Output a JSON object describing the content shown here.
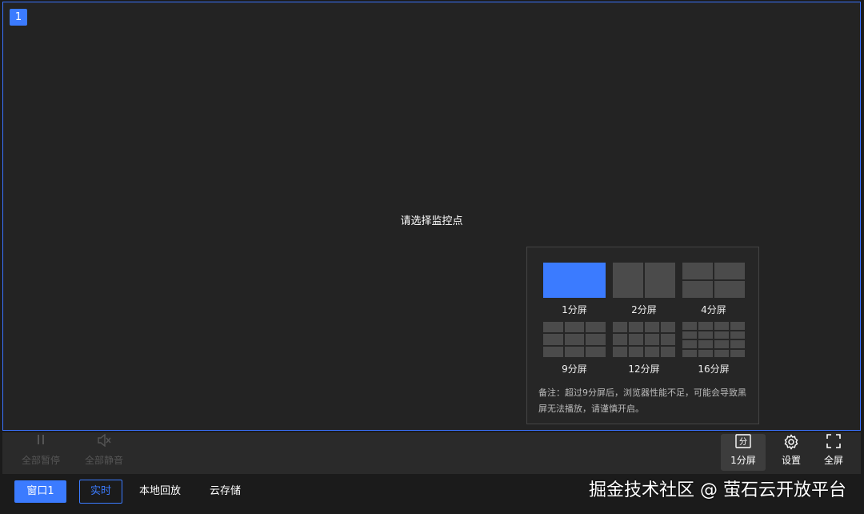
{
  "window_number": "1",
  "placeholder_text": "请选择监控点",
  "split_panel": {
    "options": [
      {
        "label": "1分屏",
        "cols": 1,
        "rows": 1,
        "active": true
      },
      {
        "label": "2分屏",
        "cols": 2,
        "rows": 1,
        "active": false
      },
      {
        "label": "4分屏",
        "cols": 2,
        "rows": 2,
        "active": false
      },
      {
        "label": "9分屏",
        "cols": 3,
        "rows": 3,
        "active": false
      },
      {
        "label": "12分屏",
        "cols": 4,
        "rows": 3,
        "active": false
      },
      {
        "label": "16分屏",
        "cols": 4,
        "rows": 4,
        "active": false
      }
    ],
    "note": "备注：超过9分屏后，浏览器性能不足，可能会导致黑屏无法播放，请谨慎开启。"
  },
  "controls": {
    "pause_all": "全部暂停",
    "mute_all": "全部静音",
    "split_icon_char": "分",
    "split_label": "1分屏",
    "settings_label": "设置",
    "fullscreen_label": "全屏"
  },
  "tabs": {
    "window_tab": "窗口1",
    "live": "实时",
    "local_playback": "本地回放",
    "cloud_storage": "云存储"
  },
  "watermark": "掘金技术社区 @ 萤石云开放平台",
  "colors": {
    "accent": "#3b7bff",
    "background": "#232323"
  }
}
